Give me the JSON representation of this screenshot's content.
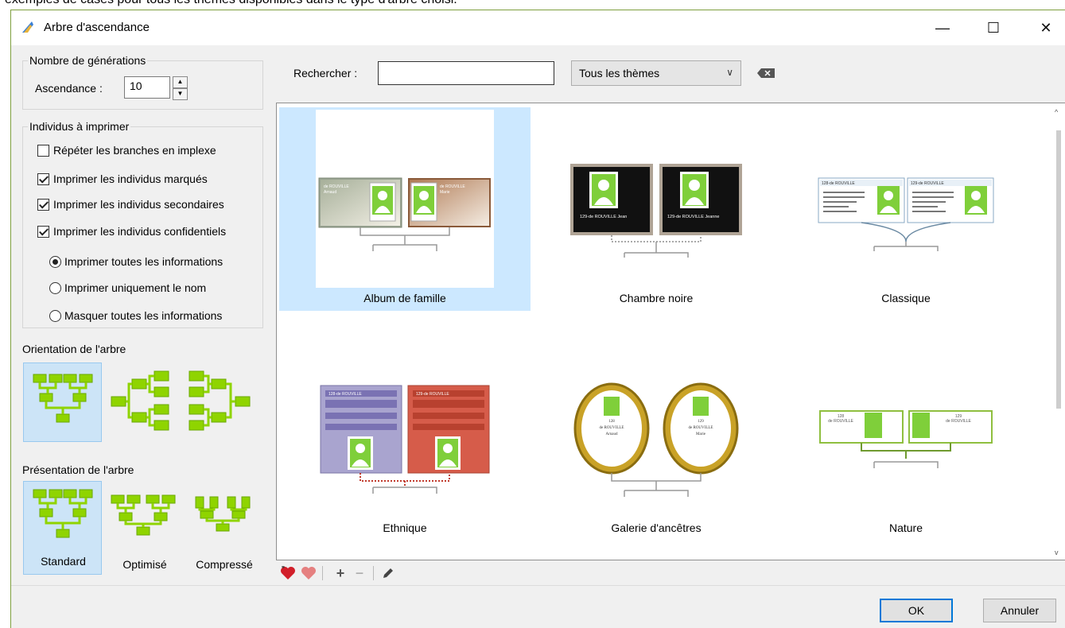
{
  "top_caption": "exemples de cases pour tous les thèmes disponibles dans le type d'arbre choisi.",
  "window": {
    "title": "Arbre d'ascendance",
    "minimize": "—",
    "maximize": "☐",
    "close": "✕"
  },
  "generations": {
    "group_label": "Nombre de générations",
    "ascendance_label": "Ascendance :",
    "ascendance_value": "10"
  },
  "individuals": {
    "group_label": "Individus à imprimer",
    "checkboxes": [
      {
        "label": "Répéter les branches en implexe",
        "checked": false
      },
      {
        "label": "Imprimer les individus marqués",
        "checked": true
      },
      {
        "label": "Imprimer les individus secondaires",
        "checked": true
      },
      {
        "label": "Imprimer les individus confidentiels",
        "checked": true
      }
    ],
    "radios": [
      {
        "label": "Imprimer toutes les informations",
        "selected": true
      },
      {
        "label": "Imprimer uniquement le nom",
        "selected": false
      },
      {
        "label": "Masquer toutes les informations",
        "selected": false
      }
    ]
  },
  "orientation": {
    "label": "Orientation de l'arbre"
  },
  "presentation": {
    "label": "Présentation de l'arbre",
    "options": [
      "Standard",
      "Optimisé",
      "Compressé"
    ]
  },
  "search": {
    "label": "Rechercher :",
    "value": ""
  },
  "theme_filter": {
    "selected": "Tous les thèmes"
  },
  "themes": [
    {
      "name": "Album de famille",
      "selected": true
    },
    {
      "name": "Chambre noire",
      "selected": false
    },
    {
      "name": "Classique",
      "selected": false
    },
    {
      "name": "Ethnique",
      "selected": false
    },
    {
      "name": "Galerie d'ancêtres",
      "selected": false
    },
    {
      "name": "Nature",
      "selected": false
    }
  ],
  "thumb_text": {
    "album_left": "de ROUVILLE",
    "album_left2": "Arnaud",
    "album_right": "de ROUVILLE",
    "album_right2": "Marie",
    "chambre_left": "129-de ROUVILLE Jean",
    "chambre_right": "129-de ROUVILLE Jeanne",
    "classique_left": "128-de ROUVILLE",
    "classique_right": "129-de ROUVILLE",
    "ethnique_left": "128-de ROUVILLE",
    "ethnique_right": "129-de ROUVILLE",
    "galerie_left_num": "128",
    "galerie_left_name": "de ROUVILLE",
    "galerie_left_first": "Arnaud",
    "galerie_right_num": "129",
    "galerie_right_name": "de ROUVILLE",
    "galerie_right_first": "Marie",
    "nature_left": "128",
    "nature_left_name": "de ROUVILLE",
    "nature_right": "129",
    "nature_right_name": "de ROUVILLE"
  },
  "buttons": {
    "ok": "OK",
    "cancel": "Annuler"
  },
  "colors": {
    "accent": "#0078d7",
    "selection": "#cce8ff",
    "tree_green": "#8fd400"
  }
}
